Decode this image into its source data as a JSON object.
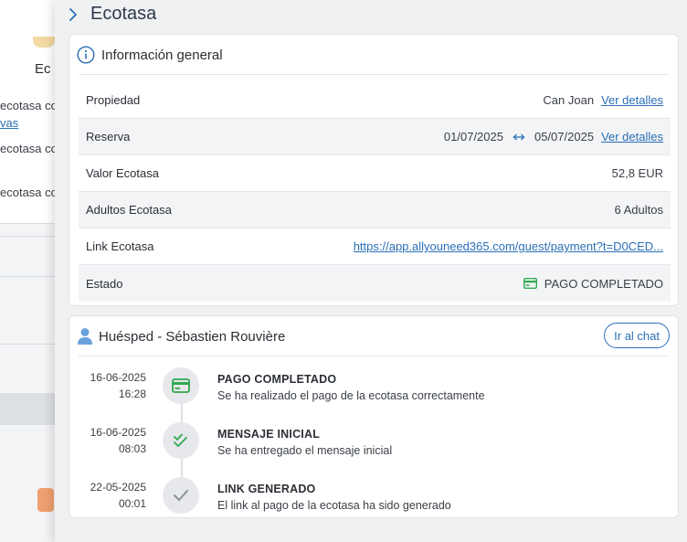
{
  "background": {
    "title_fragment": "Ec",
    "lines": [
      "ecotasa co",
      "vas",
      "ecotasa co",
      "ecotasa co"
    ]
  },
  "drawer": {
    "title": "Ecotasa"
  },
  "general": {
    "title": "Información general",
    "rows": {
      "propiedad": {
        "label": "Propiedad",
        "value": "Can Joan",
        "link": "Ver detalles"
      },
      "reserva": {
        "label": "Reserva",
        "start": "01/07/2025",
        "end": "05/07/2025",
        "link": "Ver detalles"
      },
      "valor": {
        "label": "Valor Ecotasa",
        "value": "52,8 EUR"
      },
      "adultos": {
        "label": "Adultos Ecotasa",
        "value": "6 Adultos"
      },
      "link": {
        "label": "Link Ecotasa",
        "value": "https://app.allyouneed365.com/guest/payment?t=D0CED..."
      },
      "estado": {
        "label": "Estado",
        "value": "PAGO COMPLETADO",
        "color": "#2fa84f"
      }
    }
  },
  "guest": {
    "title": "Huésped - Sébastien Rouvière",
    "chat_button": "Ir al chat",
    "timeline": [
      {
        "date": "16-06-2025",
        "time": "16:28",
        "title": "PAGO COMPLETADO",
        "desc": "Se ha realizado el pago de la ecotasa correctamente",
        "icon": "credit-card-icon"
      },
      {
        "date": "16-06-2025",
        "time": "08:03",
        "title": "MENSAJE INICIAL",
        "desc": "Se ha entregado el mensaje inicial",
        "icon": "double-check-icon"
      },
      {
        "date": "22-05-2025",
        "time": "00:01",
        "title": "LINK GENERADO",
        "desc": "El link al pago de la ecotasa ha sido generado",
        "icon": "check-icon"
      }
    ]
  },
  "colors": {
    "accent": "#2a6fb7",
    "success": "#2fa84f",
    "muted_check": "#8a9099"
  }
}
